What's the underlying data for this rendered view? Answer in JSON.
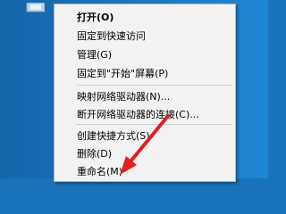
{
  "menu": {
    "items": [
      {
        "name": "menu-item-open",
        "label": "打开(O)"
      },
      {
        "name": "menu-item-pin-quick-access",
        "label": "固定到快速访问"
      },
      {
        "name": "menu-item-manage",
        "label": "管理(G)"
      },
      {
        "name": "menu-item-pin-start",
        "label": "固定到\"开始\"屏幕(P)"
      },
      {
        "name": "menu-item-map-drive",
        "label": "映射网络驱动器(N)..."
      },
      {
        "name": "menu-item-disconnect-drive",
        "label": "断开网络驱动器的连接(C)..."
      },
      {
        "name": "menu-item-create-shortcut",
        "label": "创建快捷方式(S)"
      },
      {
        "name": "menu-item-delete",
        "label": "删除(D)"
      },
      {
        "name": "menu-item-rename",
        "label": "重命名(M)"
      }
    ]
  },
  "colors": {
    "desktop": "#1a72b8",
    "menu_background": "#f2f2f2",
    "annotation_arrow": "#e02020"
  },
  "icons": {
    "desktop_icon": "this-pc-icon",
    "annotation": "arrow-pointer-icon"
  }
}
